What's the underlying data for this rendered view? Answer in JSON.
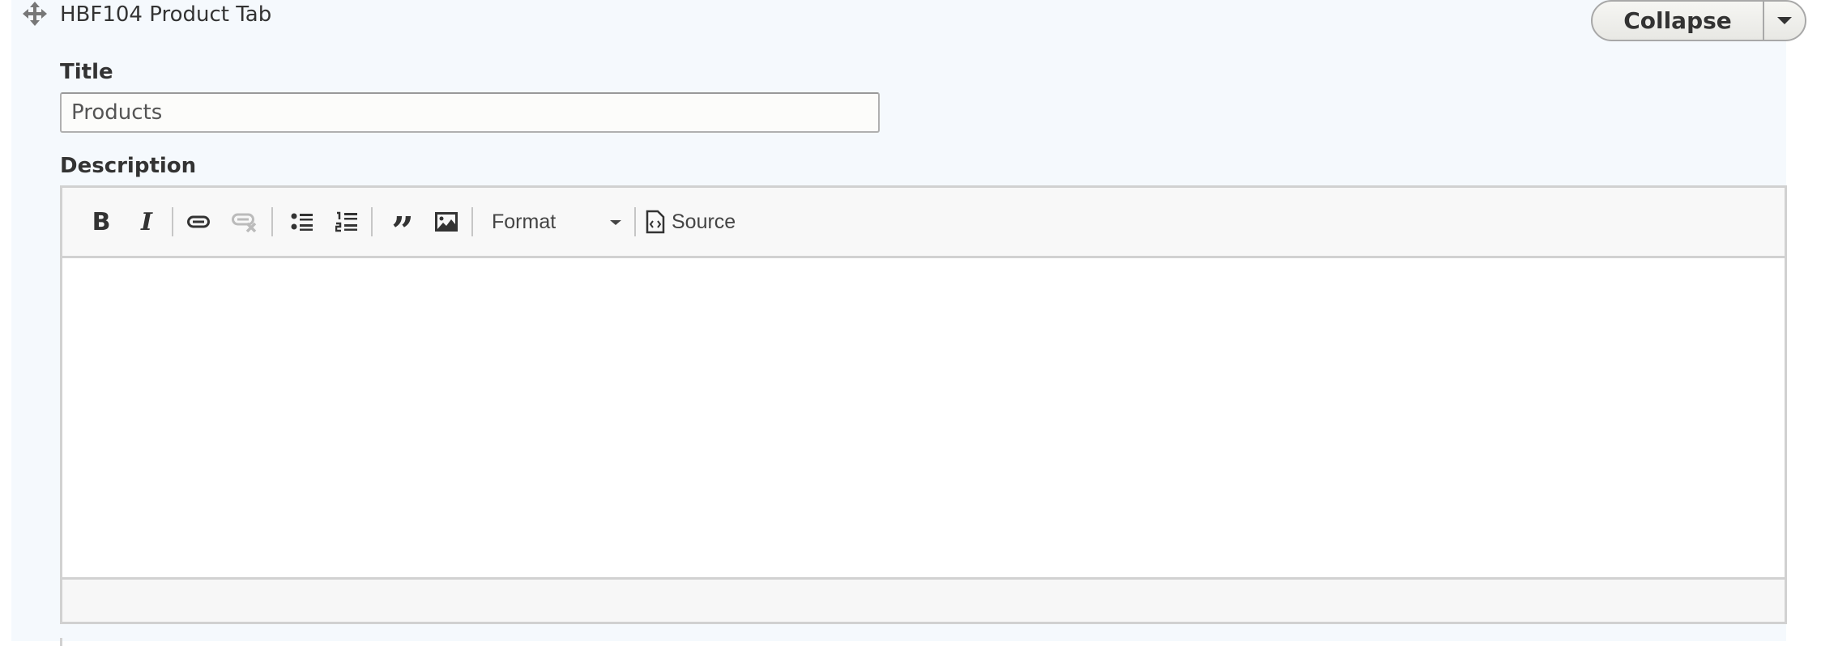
{
  "paragraph": {
    "heading": "HBF104 Product Tab",
    "drag_icon": "move-arrows-icon",
    "collapse_button": {
      "label": "Collapse",
      "toggle_icon": "caret-down-icon"
    }
  },
  "fields": {
    "title": {
      "label": "Title",
      "value": "Products"
    },
    "description": {
      "label": "Description",
      "toolbar": {
        "bold": "bold-icon",
        "italic": "italic-icon",
        "link": "link-icon",
        "unlink": "unlink-icon",
        "bulleted_list": "bulleted-list-icon",
        "numbered_list": "numbered-list-icon",
        "blockquote": "blockquote-icon",
        "image": "image-icon",
        "format": {
          "label": "Format"
        },
        "source": {
          "label": "Source",
          "icon": "source-code-icon"
        }
      },
      "content": ""
    }
  }
}
